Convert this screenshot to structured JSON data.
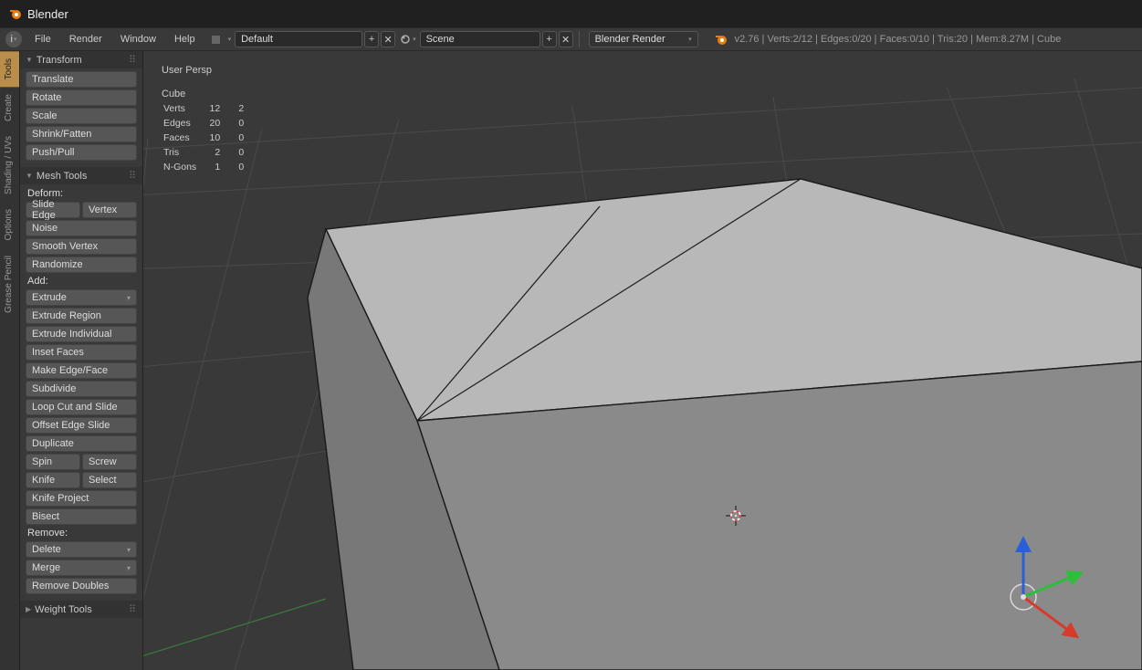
{
  "titlebar": {
    "app_name": "Blender"
  },
  "menubar": {
    "file": "File",
    "render": "Render",
    "window": "Window",
    "help": "Help",
    "layout_name": "Default",
    "scene_name": "Scene",
    "renderer": "Blender Render",
    "plus": "+",
    "x": "✕",
    "stats": "v2.76 | Verts:2/12 | Edges:0/20 | Faces:0/10 | Tris:20 | Mem:8.27M | Cube"
  },
  "vtabs": {
    "tools": "Tools",
    "create": "Create",
    "shading": "Shading / UVs",
    "options": "Options",
    "grease": "Grease Pencil"
  },
  "panel_transform": {
    "title": "Transform",
    "translate": "Translate",
    "rotate": "Rotate",
    "scale": "Scale",
    "shrink": "Shrink/Fatten",
    "pushpull": "Push/Pull"
  },
  "panel_mesh": {
    "title": "Mesh Tools",
    "deform_label": "Deform:",
    "slide_edge": "Slide Edge",
    "vertex": "Vertex",
    "noise": "Noise",
    "smooth_vertex": "Smooth Vertex",
    "randomize": "Randomize",
    "add_label": "Add:",
    "extrude": "Extrude",
    "extrude_region": "Extrude Region",
    "extrude_individual": "Extrude Individual",
    "inset": "Inset Faces",
    "make_edge": "Make Edge/Face",
    "subdivide": "Subdivide",
    "loop_cut": "Loop Cut and Slide",
    "offset_edge": "Offset Edge Slide",
    "duplicate": "Duplicate",
    "spin": "Spin",
    "screw": "Screw",
    "knife": "Knife",
    "select": "Select",
    "knife_project": "Knife Project",
    "bisect": "Bisect",
    "remove_label": "Remove:",
    "delete": "Delete",
    "merge": "Merge",
    "remove_doubles": "Remove Doubles"
  },
  "panel_weight": {
    "title": "Weight Tools"
  },
  "overlay": {
    "persp": "User Persp",
    "object": "Cube",
    "rows": [
      {
        "label": "Verts",
        "a": "12",
        "b": "2"
      },
      {
        "label": "Edges",
        "a": "20",
        "b": "0"
      },
      {
        "label": "Faces",
        "a": "10",
        "b": "0"
      },
      {
        "label": "Tris",
        "a": "2",
        "b": "0"
      },
      {
        "label": "N-Gons",
        "a": "1",
        "b": "0"
      }
    ]
  }
}
